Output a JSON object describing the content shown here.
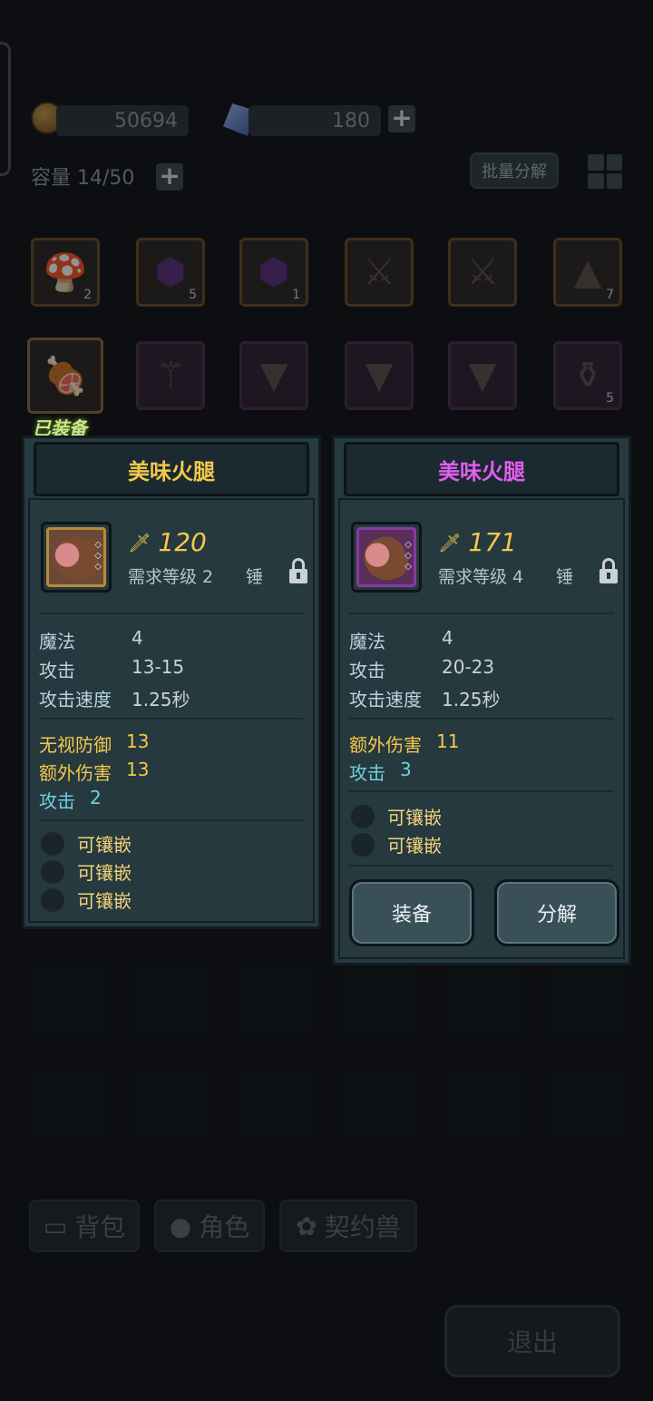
{
  "header": {
    "gold": "50694",
    "gems": "180",
    "capacity": "容量 14/50",
    "batch_decompose": "批量分解"
  },
  "inventory": [
    {
      "icon": "mushroom-icon",
      "count": "2",
      "rarity": "gold"
    },
    {
      "icon": "purple-swirl-icon",
      "count": "5",
      "rarity": "gold"
    },
    {
      "icon": "purple-swirl-icon",
      "count": "1",
      "rarity": "gold"
    },
    {
      "icon": "sword-icon",
      "count": "",
      "rarity": "gold"
    },
    {
      "icon": "sword-icon",
      "count": "",
      "rarity": "gold"
    },
    {
      "icon": "wizard-hat-icon",
      "count": "7",
      "rarity": "gold"
    },
    {
      "icon": "ham-icon",
      "count": "",
      "rarity": "gold"
    },
    {
      "icon": "staff-icon",
      "count": "",
      "rarity": "purple"
    },
    {
      "icon": "armor-icon",
      "count": "",
      "rarity": "purple"
    },
    {
      "icon": "armor-icon",
      "count": "",
      "rarity": "purple"
    },
    {
      "icon": "cloak-icon",
      "count": "",
      "rarity": "purple"
    },
    {
      "icon": "potion-icon",
      "count": "5",
      "rarity": "purple"
    }
  ],
  "equipped_tag": "已装备",
  "panels": {
    "left": {
      "name": "美味火腿",
      "name_color": "#f3c84a",
      "power": "120",
      "req_level": "需求等级 2",
      "weapon_type": "锤",
      "stats": [
        {
          "k": "魔法",
          "v": "4"
        },
        {
          "k": "攻击",
          "v": "13-15"
        },
        {
          "k": "攻击速度",
          "v": "1.25秒"
        }
      ],
      "bonuses": [
        {
          "k": "无视防御",
          "v": "13",
          "color": "yellow"
        },
        {
          "k": "额外伤害",
          "v": "13",
          "color": "yellow"
        },
        {
          "k": "攻击",
          "v": "2",
          "color": "cyan"
        }
      ],
      "sockets": [
        "可镶嵌",
        "可镶嵌",
        "可镶嵌"
      ]
    },
    "right": {
      "name": "美味火腿",
      "name_color": "#e25df0",
      "power": "171",
      "req_level": "需求等级 4",
      "weapon_type": "锤",
      "stats": [
        {
          "k": "魔法",
          "v": "4"
        },
        {
          "k": "攻击",
          "v": "20-23"
        },
        {
          "k": "攻击速度",
          "v": "1.25秒"
        }
      ],
      "bonuses": [
        {
          "k": "额外伤害",
          "v": "11",
          "color": "yellow"
        },
        {
          "k": "攻击",
          "v": "3",
          "color": "cyan"
        }
      ],
      "sockets": [
        "可镶嵌",
        "可镶嵌"
      ],
      "equip_label": "装备",
      "decompose_label": "分解"
    }
  },
  "nav": {
    "bag": "背包",
    "character": "角色",
    "pet": "契约兽"
  },
  "exit_label": "退出"
}
